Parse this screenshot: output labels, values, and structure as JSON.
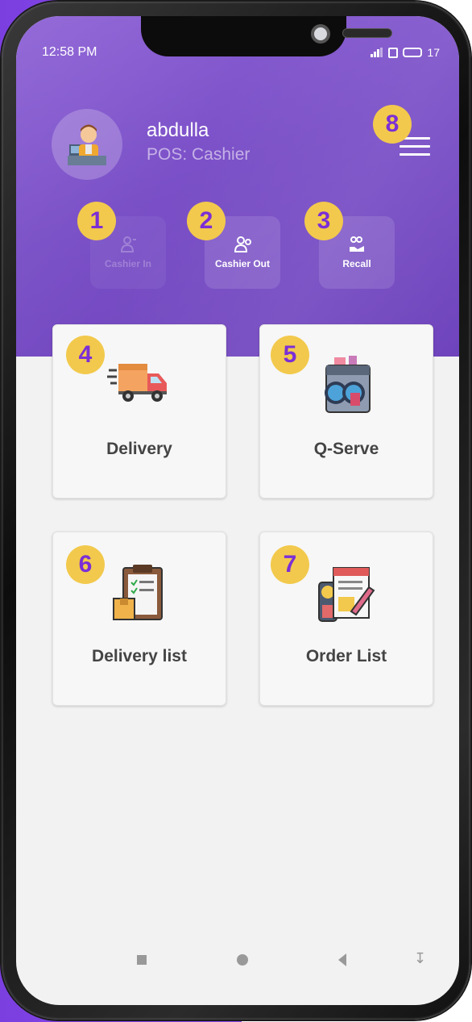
{
  "status_bar": {
    "time": "12:58 PM",
    "battery": "17"
  },
  "profile": {
    "name": "abdulla",
    "role": "POS: Cashier"
  },
  "actions": [
    {
      "label": "Cashier In",
      "enabled": false
    },
    {
      "label": "Cashier Out",
      "enabled": true
    },
    {
      "label": "Recall",
      "enabled": true
    }
  ],
  "tiles": [
    {
      "label": "Delivery",
      "icon": "delivery-truck-icon"
    },
    {
      "label": "Q-Serve",
      "icon": "washing-machine-icon"
    },
    {
      "label": "Delivery list",
      "icon": "clipboard-list-icon"
    },
    {
      "label": "Order List",
      "icon": "invoice-icon"
    }
  ],
  "badges": [
    "1",
    "2",
    "3",
    "4",
    "5",
    "6",
    "7",
    "8"
  ],
  "colors": {
    "header": "#7a4fc7",
    "badge": "#f2c94c",
    "badge_text": "#7b2fd6",
    "background": "#8b4cef"
  }
}
